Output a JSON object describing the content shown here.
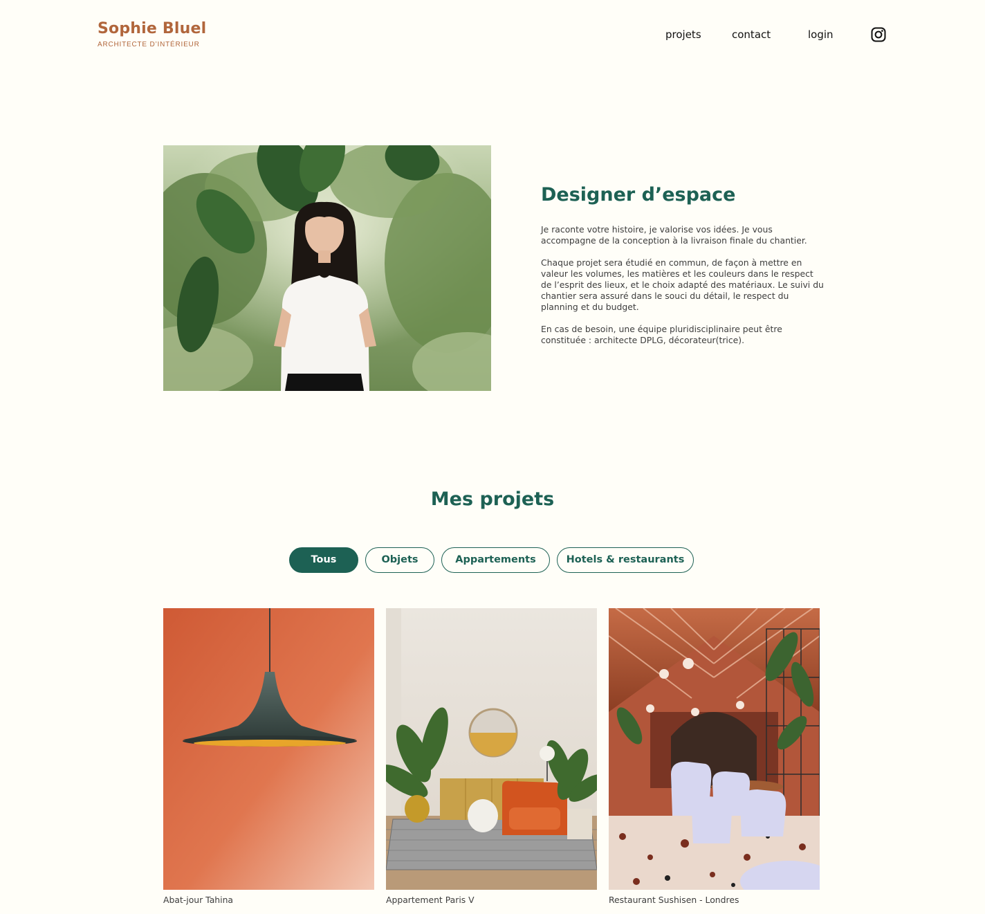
{
  "header": {
    "brand_name": "Sophie Bluel",
    "brand_subtitle": "ARCHITECTE D’INTÉRIEUR",
    "nav": {
      "projets": "projets",
      "contact": "contact",
      "login": "login",
      "social_icon": "instagram-icon"
    }
  },
  "introduction": {
    "title": "Designer d’espace",
    "paragraphs": [
      "Je raconte votre histoire, je valorise vos idées. Je vous accompagne de la conception à la livraison finale du chantier.",
      "Chaque projet sera étudié en commun, de façon à mettre en valeur les volumes, les matières et les couleurs dans le respect de l’esprit des lieux, et le choix adapté des matériaux. Le suivi du chantier sera assuré dans le souci du détail, le respect du planning et du budget.",
      "En cas de besoin, une équipe pluridisciplinaire peut être constituée : architecte DPLG, décorateur(trice)."
    ]
  },
  "portfolio": {
    "title": "Mes projets",
    "filters": [
      {
        "label": "Tous",
        "active": true
      },
      {
        "label": "Objets",
        "active": false
      },
      {
        "label": "Appartements",
        "active": false
      },
      {
        "label": "Hotels & restaurants",
        "active": false
      }
    ],
    "projects": [
      {
        "caption": "Abat-jour Tahina"
      },
      {
        "caption": "Appartement Paris V"
      },
      {
        "caption": "Restaurant Sushisen - Londres"
      }
    ]
  },
  "colors": {
    "brand": "#B1663C",
    "accent": "#1D6154",
    "background": "#FFFEF8"
  }
}
